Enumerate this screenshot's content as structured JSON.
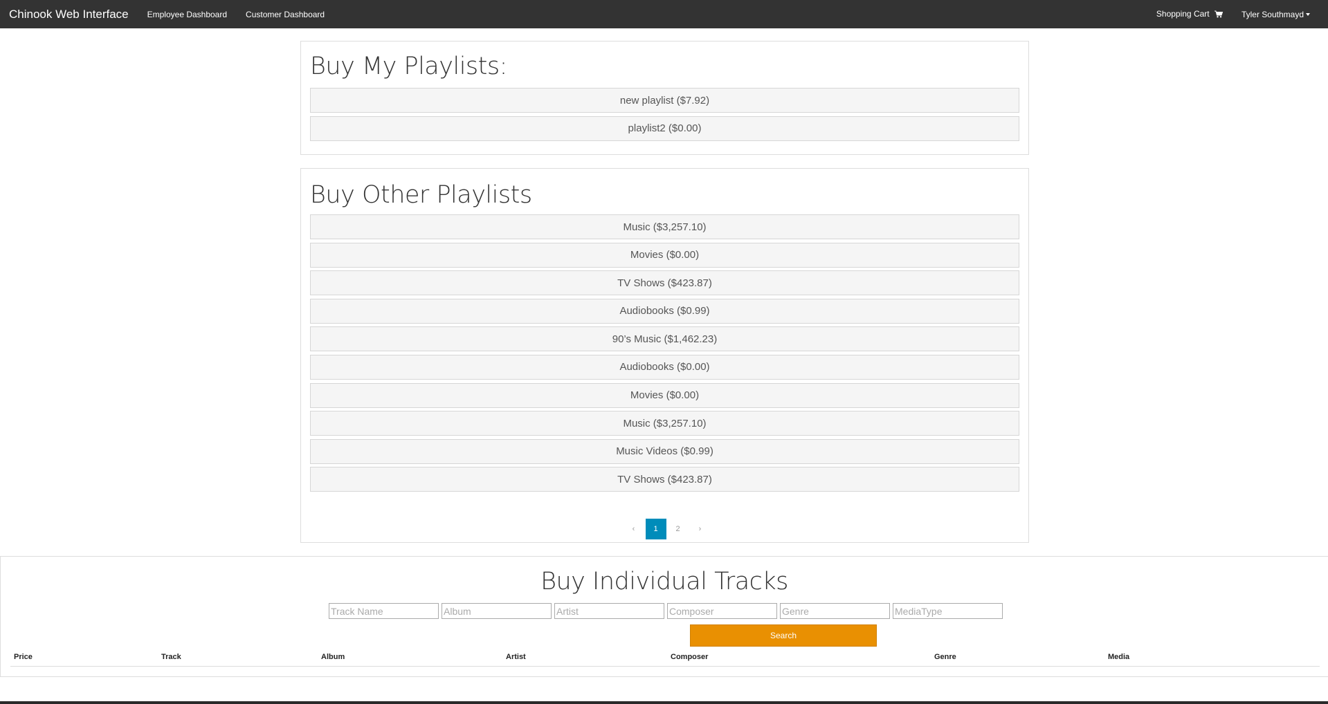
{
  "navbar": {
    "brand": "Chinook Web Interface",
    "links": [
      "Employee Dashboard",
      "Customer Dashboard"
    ],
    "cart_label": "Shopping Cart",
    "cart_icon": "shopping-cart-icon",
    "user_label": "Tyler Southmayd"
  },
  "my_playlists": {
    "title": "Buy My Playlists:",
    "items": [
      "new playlist ($7.92)",
      "playlist2 ($0.00)"
    ]
  },
  "other_playlists": {
    "title": "Buy Other Playlists",
    "items": [
      "Music ($3,257.10)",
      "Movies ($0.00)",
      "TV Shows ($423.87)",
      "Audiobooks ($0.99)",
      "90’s Music ($1,462.23)",
      "Audiobooks ($0.00)",
      "Movies ($0.00)",
      "Music ($3,257.10)",
      "Music Videos ($0.99)",
      "TV Shows ($423.87)"
    ],
    "pagination": {
      "prev": "‹",
      "pages": [
        "1",
        "2"
      ],
      "active_page": "1",
      "next": "›"
    }
  },
  "tracks": {
    "title": "Buy Individual Tracks",
    "filters": {
      "track_name": "Track Name",
      "album": "Album",
      "artist": "Artist",
      "composer": "Composer",
      "genre": "Genre",
      "media_type": "MediaType"
    },
    "search_label": "Search",
    "columns": [
      "Price",
      "Track",
      "Album",
      "Artist",
      "Composer",
      "Genre",
      "Media"
    ]
  },
  "colors": {
    "navbar": "#333333",
    "accent": "#008cba",
    "search_button": "#e99002"
  }
}
